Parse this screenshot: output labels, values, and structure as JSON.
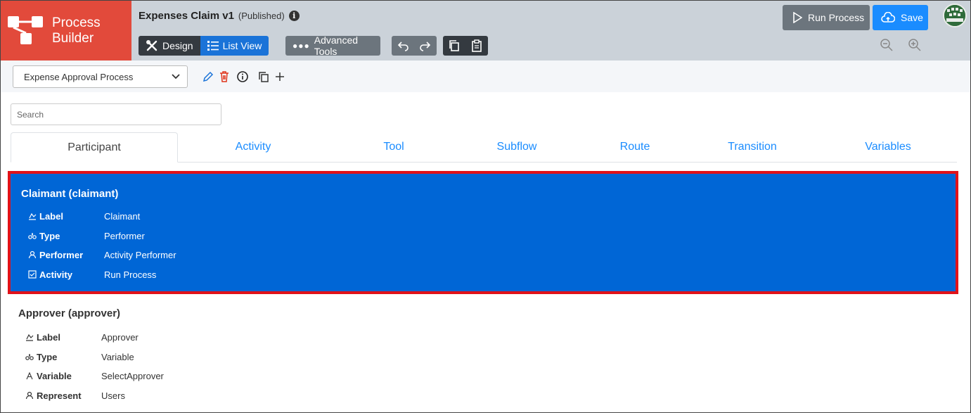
{
  "app": {
    "logo_line1": "Process",
    "logo_line2": "Builder"
  },
  "header": {
    "title": "Expenses Claim v1",
    "status": "(Published)"
  },
  "toolbar": {
    "design_label": "Design",
    "list_view_label": "List View",
    "advanced_tools_label": "Advanced Tools",
    "run_process_label": "Run Process",
    "save_label": "Save"
  },
  "process_select": {
    "value": "Expense Approval Process"
  },
  "search": {
    "placeholder": "Search"
  },
  "tabs": [
    "Participant",
    "Activity",
    "Tool",
    "Subflow",
    "Route",
    "Transition",
    "Variables"
  ],
  "participants": [
    {
      "title": "Claimant (claimant)",
      "fields": [
        {
          "icon": "label-icon",
          "key": "Label",
          "value": "Claimant"
        },
        {
          "icon": "type-icon",
          "key": "Type",
          "value": "Performer"
        },
        {
          "icon": "performer-icon",
          "key": "Performer",
          "value": "Activity Performer"
        },
        {
          "icon": "activity-icon",
          "key": "Activity",
          "value": "Run Process"
        }
      ]
    },
    {
      "title": "Approver (approver)",
      "fields": [
        {
          "icon": "label-icon",
          "key": "Label",
          "value": "Approver"
        },
        {
          "icon": "type-icon",
          "key": "Type",
          "value": "Variable"
        },
        {
          "icon": "variable-icon",
          "key": "Variable",
          "value": "SelectApprover"
        },
        {
          "icon": "represent-icon",
          "key": "Represent",
          "value": "Users"
        }
      ]
    }
  ],
  "colors": {
    "logo_bg": "#e24a3b",
    "selected_bg": "#0066d6",
    "selected_border": "#e0121a",
    "tab_link": "#1a8cff"
  }
}
